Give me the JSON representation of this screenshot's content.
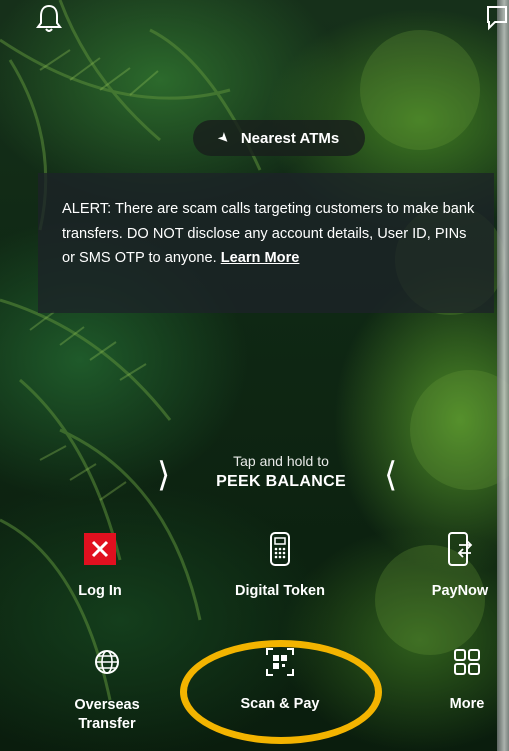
{
  "top": {
    "bell_icon": "bell-icon",
    "chat_icon": "chat-icon"
  },
  "nearest_atms": {
    "label": "Nearest ATMs"
  },
  "alert": {
    "text": "ALERT: There are scam calls targeting customers to make bank transfers. DO NOT disclose any account details, User ID, PINs or SMS OTP to anyone. ",
    "link": "Learn More"
  },
  "peek": {
    "line1": "Tap and hold to",
    "line2": "PEEK BALANCE"
  },
  "actions": {
    "login": "Log In",
    "digital_token": "Digital Token",
    "paynow": "PayNow",
    "overseas_transfer": "Overseas Transfer",
    "scan_pay": "Scan & Pay",
    "more": "More"
  },
  "colors": {
    "highlight_ring": "#f3b400",
    "login_red": "#e1101f"
  }
}
